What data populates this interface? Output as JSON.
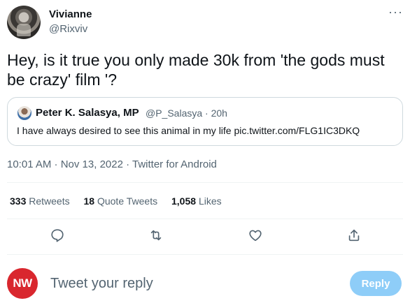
{
  "author": {
    "display_name": "Vivianne",
    "handle": "@Rixviv",
    "more_label": "···"
  },
  "tweet": {
    "text": "Hey, is it true you only made 30k from 'the gods must be crazy' film '?"
  },
  "quote": {
    "name": "Peter K. Salasya, MP",
    "meta": "@P_Salasya · 20h",
    "text": "I have always desired to see this animal in my life pic.twitter.com/FLG1IC3DKQ"
  },
  "meta_line": "10:01 AM · Nov 13, 2022 · Twitter for Android",
  "stats": {
    "retweets_count": "333",
    "retweets_label": "Retweets",
    "quotes_count": "18",
    "quotes_label": "Quote Tweets",
    "likes_count": "1,058",
    "likes_label": "Likes"
  },
  "actions": {
    "icons": [
      "reply-icon",
      "retweet-icon",
      "like-icon",
      "share-icon"
    ]
  },
  "reply": {
    "avatar_text": "NW",
    "placeholder": "Tweet your reply",
    "button_label": "Reply"
  },
  "colors": {
    "text": "#0f1419",
    "secondary": "#536471",
    "border": "#cfd9de",
    "reply_button": "#8ecdf8",
    "avatar_red": "#d9272e"
  }
}
